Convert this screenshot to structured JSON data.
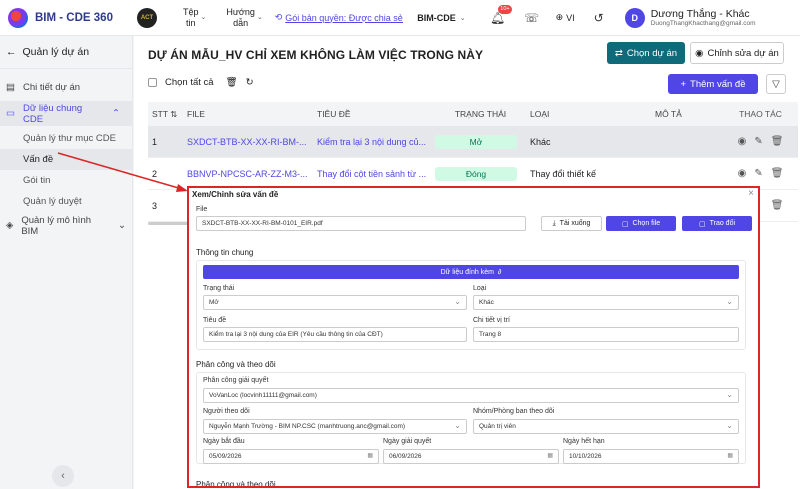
{
  "header": {
    "app_title": "BIM - CDE 360",
    "logo2_text": "ACT",
    "menu_file_line1": "Tệp",
    "menu_file_line2": "tin",
    "menu_guide_line1": "Hướng",
    "menu_guide_line2": "dẫn",
    "copyright": "Gói bản quyền: Được chia sẻ...",
    "project": "BIM-CDE",
    "notif_count": "10+",
    "language": "VI",
    "avatar_letter": "D",
    "user_name": "Dương Thắng - Khác",
    "user_email": "DuongThangKhacthang@gmail.com"
  },
  "sidebar": {
    "back_label": "Quản lý dự án",
    "items": [
      {
        "label": "Chi tiết dự án"
      },
      {
        "label": "Dữ liệu chung CDE"
      },
      {
        "label": "Quản lý thư mục CDE"
      },
      {
        "label": "Vấn đề"
      },
      {
        "label": "Gói tin"
      },
      {
        "label": "Quản lý duyệt"
      },
      {
        "label": "Quản lý mô hình BIM"
      }
    ]
  },
  "main": {
    "title": "DỰ ÁN MẪU_HV CHỈ XEM KHÔNG LÀM VIỆC TRONG NÀY",
    "choose_project": "Chọn dự án",
    "edit_project": "Chỉnh sửa dự án",
    "select_all": "Chọn tất cả",
    "add_issue": "Thêm vấn đề",
    "columns": {
      "stt": "STT",
      "file": "FILE",
      "title": "TIÊU ĐỀ",
      "status": "TRẠNG THÁI",
      "type": "LOẠI",
      "desc": "MÔ TẢ",
      "action": "THAO TÁC"
    },
    "rows": [
      {
        "stt": "1",
        "file": "SXDCT-BTB-XX-XX-RI-BM-...",
        "title": "Kiểm tra lại 3 nội dung củ...",
        "status": "Mở",
        "type": "Khác"
      },
      {
        "stt": "2",
        "file": "BBNVP-NPCSC-AR-ZZ-M3-...",
        "title": "Thay đổi cột tiền sảnh từ ...",
        "status": "Đóng",
        "type": "Thay đổi thiết kế"
      },
      {
        "stt": "3",
        "file": "",
        "title": "",
        "status": "",
        "type": ""
      }
    ]
  },
  "modal": {
    "title": "Xem/Chỉnh sửa vấn đề",
    "file_label": "File",
    "file_value": "SXDCT-BTB-XX-XX-RI-BM-0101_EIR.pdf",
    "download": "Tải xuống",
    "choose_file": "Chọn file",
    "replace": "Trao đổi",
    "general_info": "Thông tin chung",
    "attached_data": "Dữ liệu đính kèm",
    "status_label": "Trạng thái",
    "status_value": "Mở",
    "type_label": "Loại",
    "type_value": "Khác",
    "title_label": "Tiêu đề",
    "title_value": "Kiểm tra lại 3 nội dung của EIR (Yêu cầu thông tin của CĐT)",
    "location_label": "Chi tiết vị trí",
    "location_value": "Trang 8",
    "assign_section": "Phân công và theo dõi",
    "assignee_label": "Phân công giải quyết",
    "assignee_value": "VoVanLoc (locvinh11111@gmail.com)",
    "follower_label": "Người theo dõi",
    "follower_value": "Nguyễn Mạnh Trường - BIM NP.CSC (manhtruong.anc@gmail.com)",
    "group_label": "Nhóm/Phòng ban theo dõi",
    "group_value": "Quản trị viên",
    "start_label": "Ngày bắt đầu",
    "start_value": "05/09/2026",
    "resolve_label": "Ngày giải quyết",
    "resolve_value": "06/09/2026",
    "due_label": "Ngày hết hạn",
    "due_value": "10/10/2026",
    "assign_section2": "Phân công và theo dõi"
  }
}
